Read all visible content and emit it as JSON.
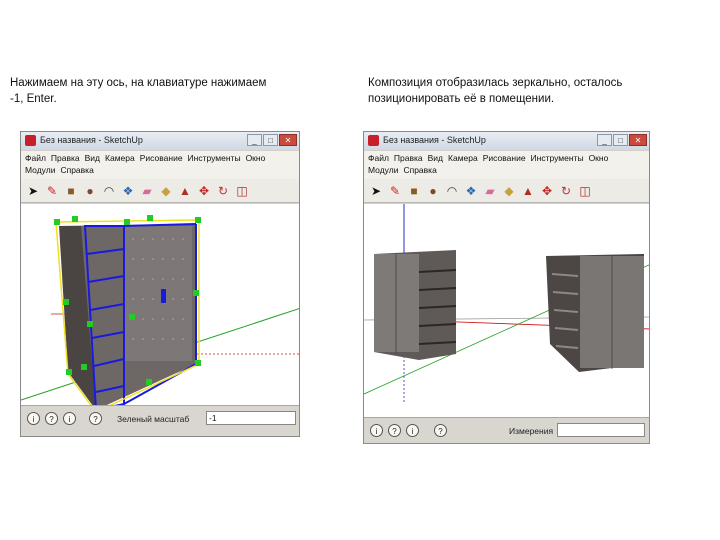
{
  "left": {
    "caption": [
      "Нажимаем на эту ось, на клавиатуре нажимаем",
      "-1, Enter."
    ],
    "window_title": "Без названия - SketchUp",
    "menu_row1": [
      "Файл",
      "Правка",
      "Вид",
      "Камера",
      "Рисование",
      "Инструменты",
      "Окно"
    ],
    "menu_row2": [
      "Модули",
      "Справка"
    ],
    "status_label": "Зеленый масштаб",
    "status_value": "-1"
  },
  "right": {
    "caption": [
      "Композиция отобразилась зеркально, осталось",
      "позиционировать её в помещении."
    ],
    "window_title": "Без названия - SketchUp",
    "menu_row1": [
      "Файл",
      "Правка",
      "Вид",
      "Камера",
      "Рисование",
      "Инструменты",
      "Окно"
    ],
    "menu_row2": [
      "Модули",
      "Справка"
    ],
    "status_label": "Измерения",
    "status_value": ""
  },
  "window_buttons": [
    "_",
    "□",
    "✕"
  ],
  "status_icons": [
    "i",
    "?",
    "i",
    "?"
  ],
  "toolbar_icons": [
    "select-icon",
    "pencil-icon",
    "rectangle-icon",
    "circle-icon",
    "arc-icon",
    "make-component-icon",
    "eraser-icon",
    "tape-measure-icon",
    "paint-bucket-icon",
    "push-pull-icon",
    "move-icon",
    "rotate-icon",
    "offset-icon"
  ],
  "colors": {
    "selection": "#1a1adf",
    "grip": "#22cc22",
    "bbox": "#f0e020",
    "cabinet": "#5a5553",
    "red_axis": "#d01010",
    "green_axis": "#20a020",
    "blue_axis": "#2030c0"
  }
}
